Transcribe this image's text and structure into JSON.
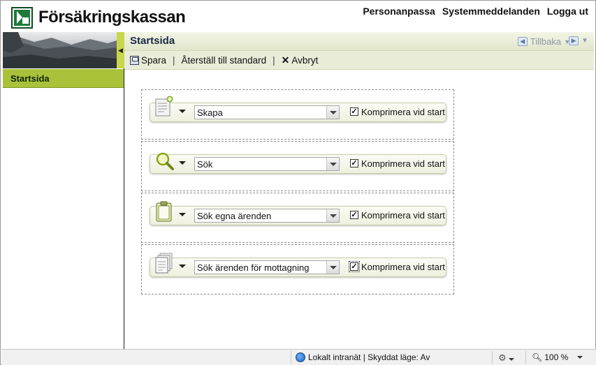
{
  "header": {
    "brand": "Försäkringskassan",
    "links": [
      "Personanpassa",
      "Systemmeddelanden",
      "Logga ut"
    ]
  },
  "nav": {
    "items": [
      {
        "label": "Startsida",
        "active": true
      }
    ]
  },
  "titlebar": {
    "title": "Startsida",
    "back_label": "Tillbaka"
  },
  "toolbar": {
    "save": "Spara",
    "reset": "Återställ till standard",
    "cancel": "Avbryt"
  },
  "widgets": [
    {
      "icon": "create-document-icon",
      "selected": "Skapa",
      "checkbox_label": "Komprimera vid start",
      "checked": true
    },
    {
      "icon": "magnifier-icon",
      "selected": "Sök",
      "checkbox_label": "Komprimera vid start",
      "checked": true
    },
    {
      "icon": "clipboard-icon",
      "selected": "Sök egna ärenden",
      "checkbox_label": "Komprimera vid start",
      "checked": true
    },
    {
      "icon": "documents-stack-icon",
      "selected": "Sök ärenden för mottagning",
      "checkbox_label": "Komprimera vid start",
      "checked": true
    }
  ],
  "statusbar": {
    "zone": "Lokalt intranät | Skyddat läge: Av",
    "zoom": "100 %"
  },
  "colors": {
    "accent_green": "#a9c23a",
    "title_bar": "#e2e6cc",
    "logo_green": "#1f7a3a"
  }
}
